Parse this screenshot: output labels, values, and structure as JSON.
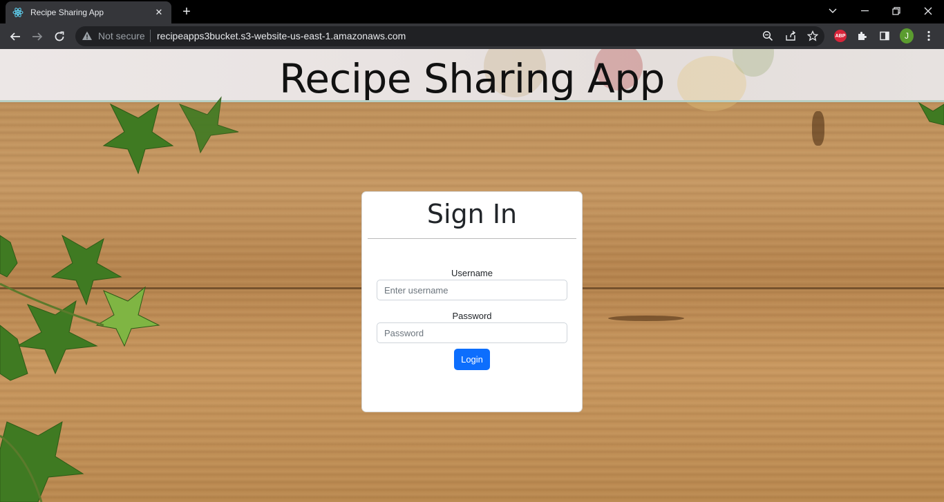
{
  "browser": {
    "tab": {
      "title": "Recipe Sharing App"
    },
    "address_bar": {
      "security_label": "Not secure",
      "url": "recipeapps3bucket.s3-website-us-east-1.amazonaws.com"
    },
    "extensions": {
      "abp_label": "ABP",
      "profile_initial": "J"
    }
  },
  "page": {
    "app_title": "Recipe Sharing App",
    "signin": {
      "heading": "Sign In",
      "username_label": "Username",
      "username_placeholder": "Enter username",
      "password_label": "Password",
      "password_placeholder": "Password",
      "login_label": "Login"
    }
  },
  "colors": {
    "primary_button": "#0d6efd",
    "chrome_toolbar": "#35363a",
    "omnibox": "#202124"
  }
}
